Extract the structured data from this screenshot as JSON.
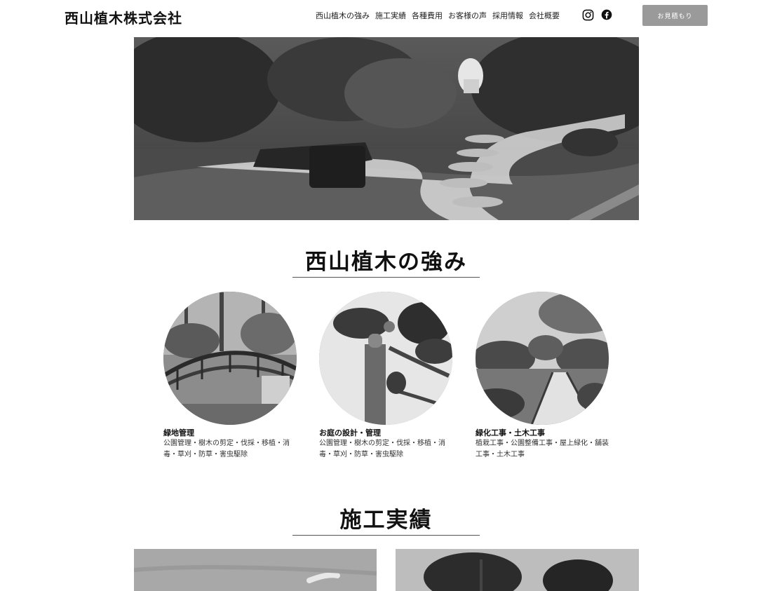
{
  "header": {
    "logo": "西山植木株式会社",
    "nav": [
      "西山植木の強み",
      "施工実績",
      "各種費用",
      "お客様の声",
      "採用情報",
      "会社概要"
    ],
    "social": [
      "instagram-icon",
      "facebook-icon"
    ],
    "quote_button": "お見積もり"
  },
  "strengths": {
    "title": "西山植木の強み",
    "cards": [
      {
        "title": "緑地管理",
        "desc": "公園管理・樹木の剪定・伐採・移植・消毒・草刈・防草・害虫駆除"
      },
      {
        "title": "お庭の設計・管理",
        "desc": "公園管理・樹木の剪定・伐採・移植・消毒・草刈・防草・害虫駆除"
      },
      {
        "title": "緑化工事・土木工事",
        "desc": "植栽工事・公園整備工事・屋上緑化・舗装工事・土木工事"
      }
    ]
  },
  "works": {
    "title": "施工実績"
  }
}
